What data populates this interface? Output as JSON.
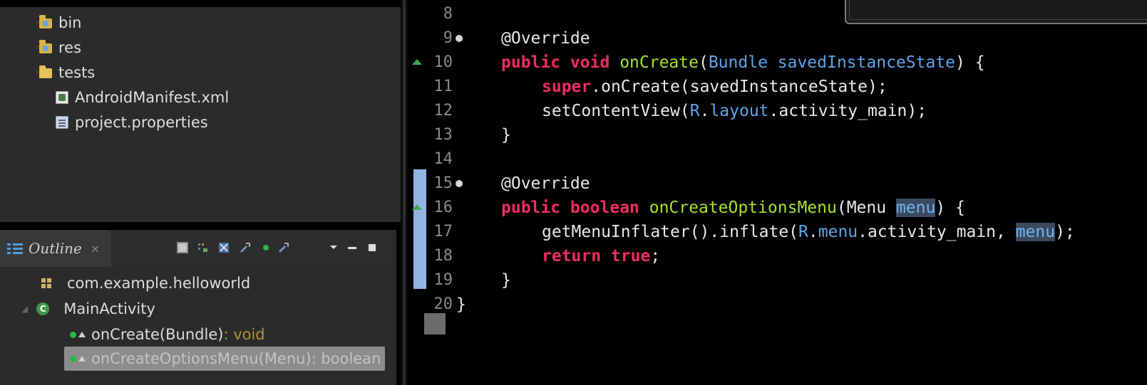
{
  "explorer": {
    "items": [
      {
        "label": "bin",
        "icon": "package-folder-icon"
      },
      {
        "label": "res",
        "icon": "package-folder-icon"
      },
      {
        "label": "tests",
        "icon": "folder-icon"
      },
      {
        "label": "AndroidManifest.xml",
        "icon": "xml-file-icon"
      },
      {
        "label": "project.properties",
        "icon": "properties-file-icon"
      }
    ]
  },
  "outline": {
    "title": "Outline",
    "close": "×",
    "items": [
      {
        "label": "com.example.helloworld",
        "icon": "package-icon"
      },
      {
        "label": "MainActivity",
        "icon": "class-icon",
        "icon_letter": "C"
      },
      {
        "label": "onCreate(Bundle)",
        "ret": " : void",
        "icon": "method-icon"
      },
      {
        "label": "onCreateOptionsMenu(Menu)",
        "ret": " : boolean",
        "icon": "method-icon",
        "selected": true
      }
    ]
  },
  "editor": {
    "line_numbers": [
      "8",
      "9",
      "10",
      "11",
      "12",
      "13",
      "14",
      "15",
      "16",
      "17",
      "18",
      "19",
      "20"
    ],
    "lines": {
      "l9_annot": "@Override",
      "l10_kw": "public void",
      "l10_fn": "onCreate",
      "l10_p1": "(",
      "l10_ty": "Bundle savedInstanceState",
      "l10_p2": ") {",
      "l11_kw": "super",
      "l11_rest": ".onCreate(savedInstanceState);",
      "l12_a": "setContentView(",
      "l12_r": "R",
      "l12_d1": ".",
      "l12_layout": "layout",
      "l12_b": ".activity_main);",
      "l13": "}",
      "l15_annot": "@Override",
      "l16_kw": "public boolean",
      "l16_fn": "onCreateOptionsMenu",
      "l16_a": "(Menu ",
      "l16_menu": "menu",
      "l16_b": ") {",
      "l17_a": "getMenuInflater().inflate(",
      "l17_r": "R",
      "l17_d1": ".",
      "l17_menufld": "menu",
      "l17_b": ".activity_main, ",
      "l17_menu": "menu",
      "l17_c": ");",
      "l18_kw": "return true",
      "l18_b": ";",
      "l19": "}",
      "l20": "}"
    }
  },
  "colors": {
    "keyword": "#ef2d61",
    "method": "#a6e22e",
    "type": "#5fa3e8",
    "occurrence_bar": "#93b5e3"
  }
}
